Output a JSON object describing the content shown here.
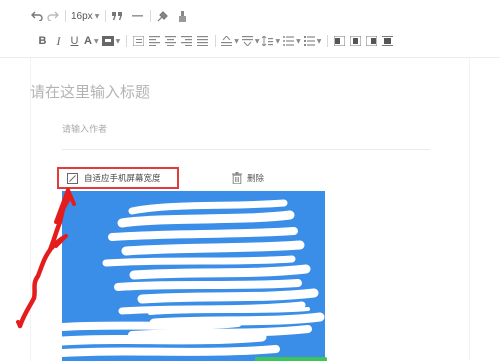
{
  "toolbar": {
    "font_size": "16px",
    "bold": "B",
    "italic": "I",
    "underline": "U",
    "font_color": "A"
  },
  "editor": {
    "title_placeholder": "请在这里输入标题",
    "author_placeholder": "请输入作者"
  },
  "image_toolbar": {
    "fit_screen_label": "自适应手机屏幕宽度",
    "delete_label": "删除"
  },
  "colors": {
    "image_blue": "#3b8ee8",
    "highlight_red": "#e23b3b",
    "annotation_red": "#e51c1c",
    "button_green": "#3ec45e"
  }
}
